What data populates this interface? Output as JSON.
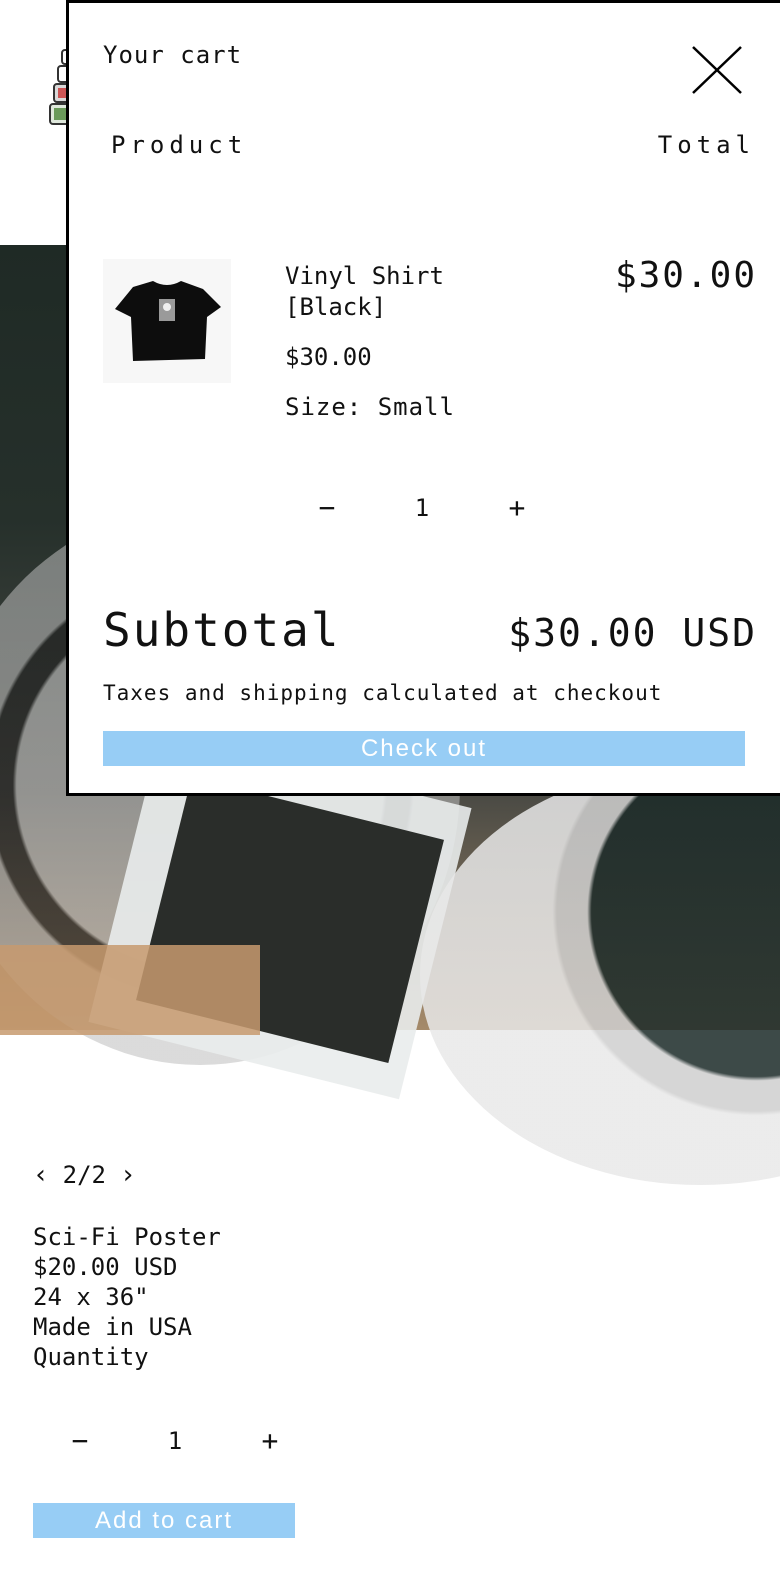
{
  "cart": {
    "title": "Your cart",
    "columns": {
      "product": "Product",
      "total": "Total"
    },
    "item": {
      "name": "Vinyl Shirt [Black]",
      "price": "$30.00",
      "size": "Size: Small",
      "quantity": "1",
      "line_total": "$30.00",
      "thumbnail_icon": "tshirt-icon"
    },
    "subtotal_label": "Subtotal",
    "subtotal_value": "$30.00 USD",
    "tax_note": "Taxes and shipping calculated at checkout",
    "checkout_label": "Check out",
    "accent": "#97cdf5"
  },
  "product": {
    "pager": "2/2",
    "info": "Sci-Fi Poster\n$20.00 USD\n24 x 36\"\nMade in USA\nQuantity",
    "quantity": "1",
    "add_label": "Add to cart"
  },
  "icons": {
    "close": "close-icon",
    "minus": "minus-icon",
    "plus": "plus-icon",
    "prev": "chevron-left-icon",
    "next": "chevron-right-icon"
  }
}
